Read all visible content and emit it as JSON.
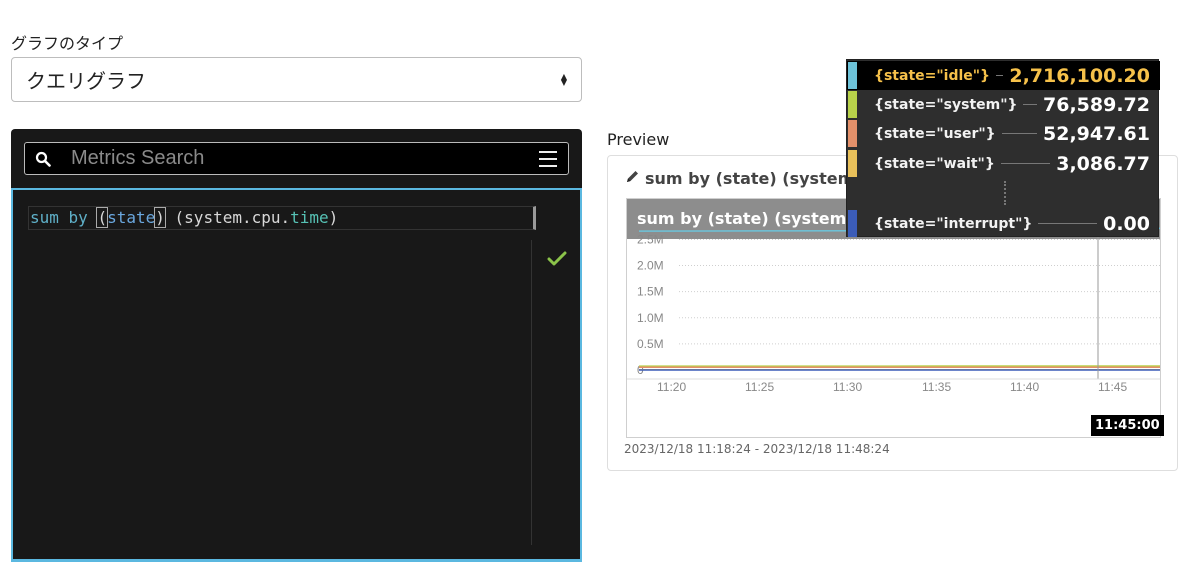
{
  "graph_type": {
    "label": "グラフのタイプ",
    "selected": "クエリグラフ"
  },
  "editor": {
    "search_placeholder": "Metrics Search",
    "query": {
      "t1": "sum",
      "t2": " ",
      "t3": "by",
      "t4": " ",
      "t5": "(",
      "t6": "state",
      "t7": ")",
      "t8": " (system.cpu.",
      "t9": "time",
      "t10": ")"
    },
    "status": "valid",
    "colors": {
      "border": "#5bb8e0",
      "check": "#8bc34a",
      "background": "#181818"
    }
  },
  "preview": {
    "label": "Preview",
    "card_title": "sum by (state) (system.",
    "graph_title": "sum by (state) (system.c",
    "time_range": "2023/12/18 11:18:24 - 2023/12/18 11:48:24",
    "hover_time": "11:45:00"
  },
  "chart_data": {
    "type": "line",
    "title": "sum by (state) (system.c",
    "y_ticks": [
      "2.5M",
      "2.0M",
      "1.5M",
      "1.0M",
      "0.5M",
      "0"
    ],
    "x_ticks": [
      "11:20",
      "11:25",
      "11:30",
      "11:35",
      "11:40",
      "11:45"
    ],
    "ylim": [
      0,
      2700000
    ],
    "grid": true,
    "series": [
      {
        "name": "{state=\"idle\"}",
        "color": "#6dc3d9",
        "values": [
          2660000,
          2662000,
          2664000,
          2668000,
          2672000,
          2690000,
          2716100.2,
          2712000
        ]
      },
      {
        "name": "{state=\"system\"}",
        "color": "#b8d24a",
        "values": [
          74000,
          74500,
          75000,
          75500,
          76000,
          76300,
          76589.72,
          76700
        ]
      },
      {
        "name": "{state=\"user\"}",
        "color": "#e3906a",
        "values": [
          51000,
          51300,
          51700,
          52000,
          52300,
          52700,
          52947.61,
          53000
        ]
      },
      {
        "name": "{state=\"wait\"}",
        "color": "#e8c05a",
        "values": [
          3000,
          3010,
          3030,
          3050,
          3060,
          3080,
          3086.77,
          3090
        ]
      },
      {
        "name": "{state=\"interrupt\"}",
        "color": "#3b5cb8",
        "values": [
          0,
          0,
          0,
          0,
          0,
          0,
          0,
          0
        ]
      }
    ],
    "x_minutes": [
      11.25,
      11.3,
      11.35,
      11.42,
      11.55,
      11.67,
      11.75,
      11.8
    ]
  },
  "tooltip": {
    "rows": [
      {
        "label": "{state=\"idle\"}",
        "value": "2,716,100.20",
        "color": "#6dc3d9",
        "active": true
      },
      {
        "label": "{state=\"system\"}",
        "value": "76,589.72",
        "color": "#b8d24a",
        "active": false
      },
      {
        "label": "{state=\"user\"}",
        "value": "52,947.61",
        "color": "#e3906a",
        "active": false
      },
      {
        "label": "{state=\"wait\"}",
        "value": "3,086.77",
        "color": "#e8c05a",
        "active": false
      },
      {
        "label": "{state=\"interrupt\"}",
        "value": "0.00",
        "color": "#3b5cb8",
        "active": false
      }
    ]
  }
}
